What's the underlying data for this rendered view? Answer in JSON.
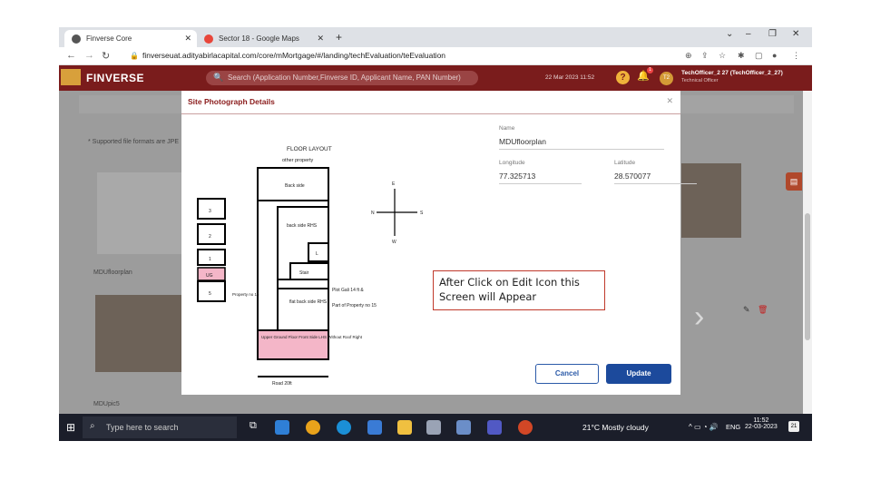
{
  "browser": {
    "tabs": [
      {
        "title": "Finverse Core",
        "icon": "app-icon"
      },
      {
        "title": "Sector 18 - Google Maps",
        "icon": "maps-icon"
      }
    ],
    "url": "finverseuat.adityabirlacapital.com/core/mMortgage/#/landing/techEvaluation/teEvaluation"
  },
  "app": {
    "brand": "FINVERSE",
    "search_placeholder": "Search (Application Number,Finverse ID, Applicant Name, PAN Number)",
    "date": "22 Mar 2023 11:52",
    "notification_count": "1",
    "avatar": "T2",
    "user_name": "TechOfficer_2 27 (TechOfficer_2_27)",
    "user_role": "Technical Officer"
  },
  "background": {
    "supported_formats": "* Supported file formats are JPE",
    "thumb1_label": "MDUfloorplan",
    "thumb2_label": "MDUpic5"
  },
  "modal": {
    "title": "Site Photograph Details",
    "name_label": "Name",
    "name_value": "MDUfloorplan",
    "longitude_label": "Longitude",
    "longitude_value": "77.325713",
    "latitude_label": "Latitude",
    "latitude_value": "28.570077",
    "cancel_label": "Cancel",
    "update_label": "Update"
  },
  "floorplan": {
    "title": "FLOOR LAYOUT",
    "other_property": "other property",
    "back_side": "Back side",
    "back_side_rhs": "back side RHS",
    "l": "L",
    "stair": "Stair",
    "flat_back_side": "flat back side RHS",
    "upper_ground": "Upper Ground Floor Front Side LHS Without Roof Right",
    "road": "Road 20ft",
    "plot_gali": "Plot Gali 14 ft &",
    "part_of_property": "Part of Property no 15",
    "property_no": "Property no 16",
    "boxes": [
      "3",
      "2",
      "1",
      "UG",
      "5"
    ],
    "compass": {
      "n": "N",
      "s": "S",
      "e": "E",
      "w": "W"
    }
  },
  "taskbar": {
    "search_placeholder": "Type here to search",
    "weather": "21°C  Mostly cloudy",
    "lang": "ENG",
    "time": "11:52",
    "date": "22-03-2023",
    "notifications": "21"
  },
  "callout": "After Click on Edit Icon this Screen will Appear",
  "colors": {
    "header": "#7a1c1c",
    "accent": "#1c4a9c",
    "title": "#8a1b1b",
    "pink": "#f4b6c8"
  }
}
